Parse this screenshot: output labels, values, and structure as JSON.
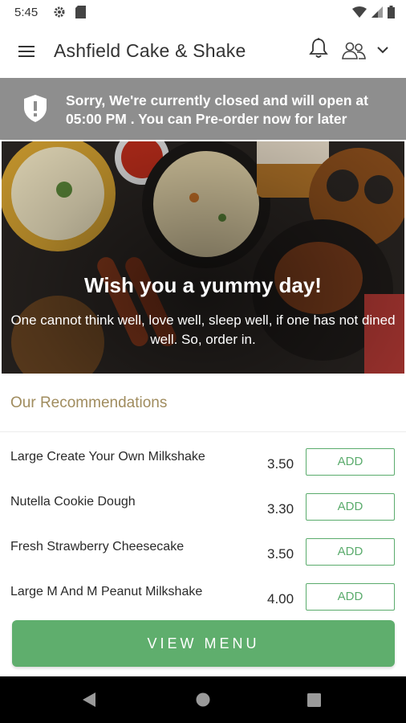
{
  "status_bar": {
    "time": "5:45"
  },
  "header": {
    "title": "Ashfield Cake & Shake"
  },
  "notice": {
    "message": "Sorry, We're currently closed and will open at 05:00 PM . You can Pre-order now for later"
  },
  "hero": {
    "title": "Wish you a yummy day!",
    "subtitle": "One cannot think well, love well, sleep well, if one has not dined well. So, order in."
  },
  "recommendations": {
    "heading": "Our Recommendations",
    "items": [
      {
        "name": "Large Create Your Own Milkshake",
        "price": "3.50",
        "action": "ADD"
      },
      {
        "name": "Nutella Cookie Dough",
        "price": "3.30",
        "action": "ADD"
      },
      {
        "name": "Fresh Strawberry Cheesecake",
        "price": "3.50",
        "action": "ADD"
      },
      {
        "name": "Large M And M Peanut Milkshake",
        "price": "4.00",
        "action": "ADD"
      }
    ]
  },
  "footer": {
    "view_menu_label": "VIEW MENU"
  },
  "colors": {
    "accent_green": "#5fae6d",
    "heading_gold": "#a08c5e",
    "notice_gray": "#8e8e8e"
  }
}
